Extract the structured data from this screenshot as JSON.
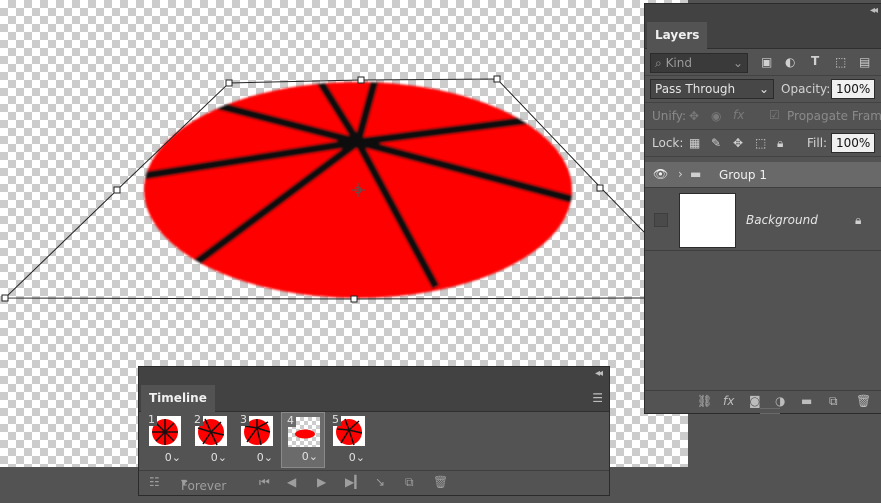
{
  "colors": {
    "shape_fill": "#ff0000",
    "stripe": "#111111",
    "panel_bg": "#535353",
    "panel_header": "#424242"
  },
  "layers_panel": {
    "tab_title": "Layers",
    "filter_placeholder": "Kind",
    "blend_mode": "Pass Through",
    "opacity_label": "Opacity:",
    "opacity_value": "100%",
    "unify_label": "Unify:",
    "propagate_label": "Propagate Frame",
    "lock_label": "Lock:",
    "fill_label": "Fill:",
    "fill_value": "100%",
    "layers": [
      {
        "name": "Group 1",
        "type": "group",
        "visible": true
      },
      {
        "name": "Background",
        "type": "background",
        "visible": false,
        "locked": true
      }
    ],
    "filter_icons": [
      "image-filter-icon",
      "adjustment-filter-icon",
      "type-filter-icon",
      "shape-filter-icon",
      "smart-object-filter-icon"
    ],
    "bottom_icons": [
      "link-icon",
      "fx-icon",
      "mask-icon",
      "adjustment-icon",
      "folder-icon",
      "new-layer-icon",
      "trash-icon"
    ]
  },
  "timeline_panel": {
    "tab_title": "Timeline",
    "loop_option": "Forever",
    "frames": [
      {
        "number": "1",
        "delay": "0",
        "selected": false
      },
      {
        "number": "2",
        "delay": "0",
        "selected": false
      },
      {
        "number": "3",
        "delay": "0",
        "selected": false
      },
      {
        "number": "4",
        "delay": "0",
        "selected": true
      },
      {
        "number": "5",
        "delay": "0",
        "selected": false
      }
    ],
    "controls": [
      "convert-icon",
      "first-frame-icon",
      "prev-frame-icon",
      "play-icon",
      "next-frame-icon",
      "tween-icon",
      "duplicate-frame-icon",
      "delete-frame-icon"
    ]
  }
}
